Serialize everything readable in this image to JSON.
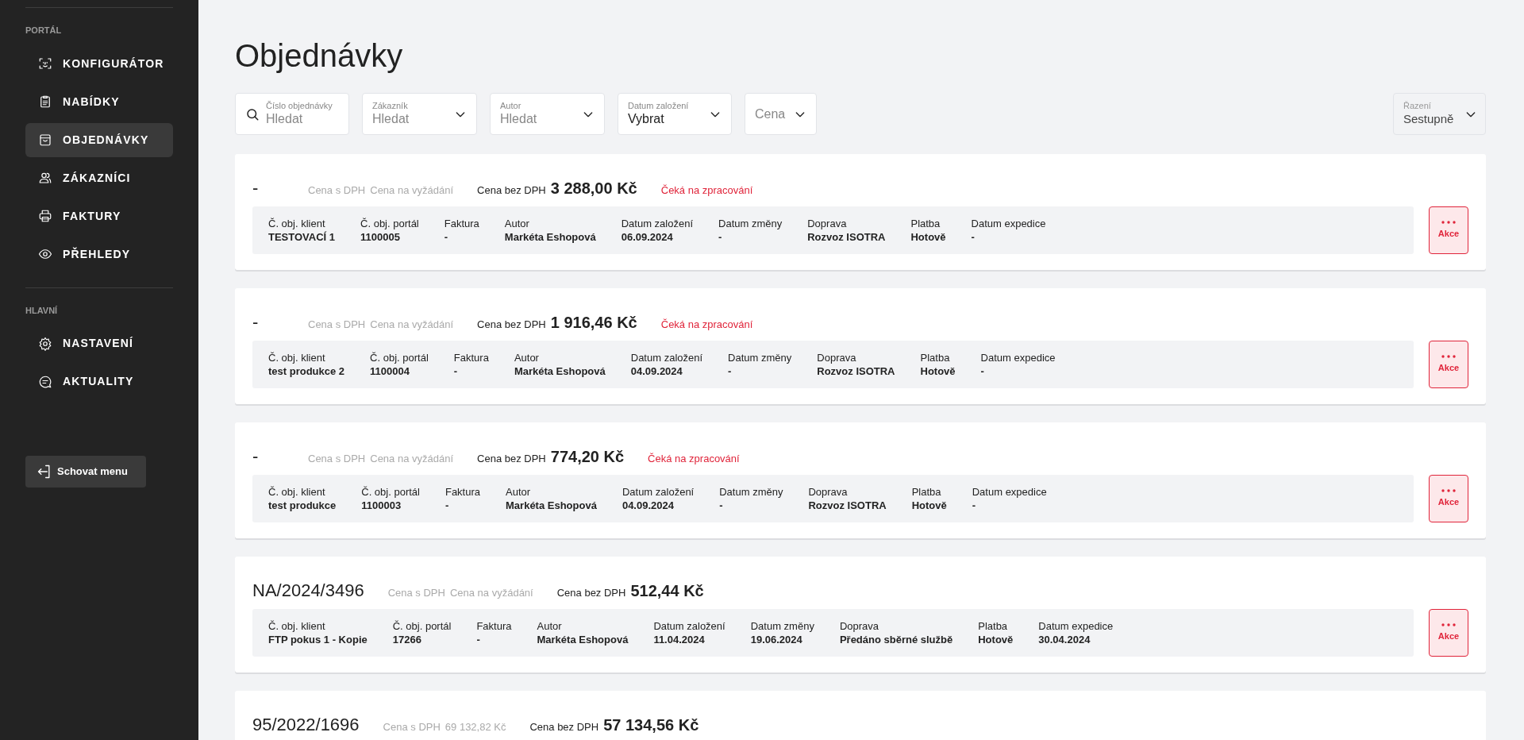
{
  "sidebar": {
    "sections": [
      {
        "heading": "PORTÁL",
        "items": [
          {
            "label": "KONFIGURÁTOR",
            "selected": false
          },
          {
            "label": "NABÍDKY",
            "selected": false
          },
          {
            "label": "OBJEDNÁVKY",
            "selected": true
          },
          {
            "label": "ZÁKAZNÍCI",
            "selected": false
          },
          {
            "label": "FAKTURY",
            "selected": false
          },
          {
            "label": "PŘEHLEDY",
            "selected": false
          }
        ]
      },
      {
        "heading": "HLAVNÍ",
        "items": [
          {
            "label": "NASTAVENÍ",
            "selected": false
          },
          {
            "label": "AKTUALITY",
            "selected": false
          }
        ]
      }
    ],
    "hide_button": "Schovat menu"
  },
  "page": {
    "title": "Objednávky"
  },
  "filters": [
    {
      "kind": "search",
      "label": "Číslo objednávky",
      "placeholder": "Hledat"
    },
    {
      "kind": "select",
      "label": "Zákazník",
      "placeholder": "Hledat"
    },
    {
      "kind": "select",
      "label": "Autor",
      "placeholder": "Hledat"
    },
    {
      "kind": "select",
      "label": "Datum založení",
      "value": "Vybrat"
    },
    {
      "kind": "select",
      "placeholder": "Cena"
    }
  ],
  "sort": {
    "label": "Řazení",
    "value": "Sestupně"
  },
  "orders": [
    {
      "number": "-",
      "vat_label": "Cena s DPH",
      "vat_value": "Cena na vyžádání",
      "net_label": "Cena bez DPH",
      "net_value": "3 288,00 Kč",
      "status": "Čeká na zpracování",
      "details": [
        {
          "label": "Č. obj. klient",
          "value": "TESTOVACÍ 1"
        },
        {
          "label": "Č. obj. portál",
          "value": "1100005"
        },
        {
          "label": "Faktura",
          "value": "-"
        },
        {
          "label": "Autor",
          "value": "Markéta Eshopová"
        },
        {
          "label": "Datum založení",
          "value": "06.09.2024"
        },
        {
          "label": "Datum změny",
          "value": "-"
        },
        {
          "label": "Doprava",
          "value": "Rozvoz ISOTRA"
        },
        {
          "label": "Platba",
          "value": "Hotově"
        },
        {
          "label": "Datum expedice",
          "value": "-"
        }
      ],
      "action": "Akce"
    },
    {
      "number": "-",
      "vat_label": "Cena s DPH",
      "vat_value": "Cena na vyžádání",
      "net_label": "Cena bez DPH",
      "net_value": "1 916,46 Kč",
      "status": "Čeká na zpracování",
      "details": [
        {
          "label": "Č. obj. klient",
          "value": "test produkce 2"
        },
        {
          "label": "Č. obj. portál",
          "value": "1100004"
        },
        {
          "label": "Faktura",
          "value": "-"
        },
        {
          "label": "Autor",
          "value": "Markéta Eshopová"
        },
        {
          "label": "Datum založení",
          "value": "04.09.2024"
        },
        {
          "label": "Datum změny",
          "value": "-"
        },
        {
          "label": "Doprava",
          "value": "Rozvoz ISOTRA"
        },
        {
          "label": "Platba",
          "value": "Hotově"
        },
        {
          "label": "Datum expedice",
          "value": "-"
        }
      ],
      "action": "Akce"
    },
    {
      "number": "-",
      "vat_label": "Cena s DPH",
      "vat_value": "Cena na vyžádání",
      "net_label": "Cena bez DPH",
      "net_value": "774,20 Kč",
      "status": "Čeká na zpracování",
      "details": [
        {
          "label": "Č. obj. klient",
          "value": "test produkce"
        },
        {
          "label": "Č. obj. portál",
          "value": "1100003"
        },
        {
          "label": "Faktura",
          "value": "-"
        },
        {
          "label": "Autor",
          "value": "Markéta Eshopová"
        },
        {
          "label": "Datum založení",
          "value": "04.09.2024"
        },
        {
          "label": "Datum změny",
          "value": "-"
        },
        {
          "label": "Doprava",
          "value": "Rozvoz ISOTRA"
        },
        {
          "label": "Platba",
          "value": "Hotově"
        },
        {
          "label": "Datum expedice",
          "value": "-"
        }
      ],
      "action": "Akce"
    },
    {
      "number": "NA/2024/3496",
      "vat_label": "Cena s DPH",
      "vat_value": "Cena na vyžádání",
      "net_label": "Cena bez DPH",
      "net_value": "512,44 Kč",
      "details": [
        {
          "label": "Č. obj. klient",
          "value": "FTP pokus 1 - Kopie"
        },
        {
          "label": "Č. obj. portál",
          "value": "17266"
        },
        {
          "label": "Faktura",
          "value": "-"
        },
        {
          "label": "Autor",
          "value": "Markéta Eshopová"
        },
        {
          "label": "Datum založení",
          "value": "11.04.2024"
        },
        {
          "label": "Datum změny",
          "value": "19.06.2024"
        },
        {
          "label": "Doprava",
          "value": "Předáno sběrné službě"
        },
        {
          "label": "Platba",
          "value": "Hotově"
        },
        {
          "label": "Datum expedice",
          "value": "30.04.2024"
        }
      ],
      "action": "Akce"
    },
    {
      "number": "95/2022/1696",
      "vat_label": "Cena s DPH",
      "vat_value": "69 132,82 Kč",
      "net_label": "Cena bez DPH",
      "net_value": "57 134,56 Kč"
    }
  ]
}
